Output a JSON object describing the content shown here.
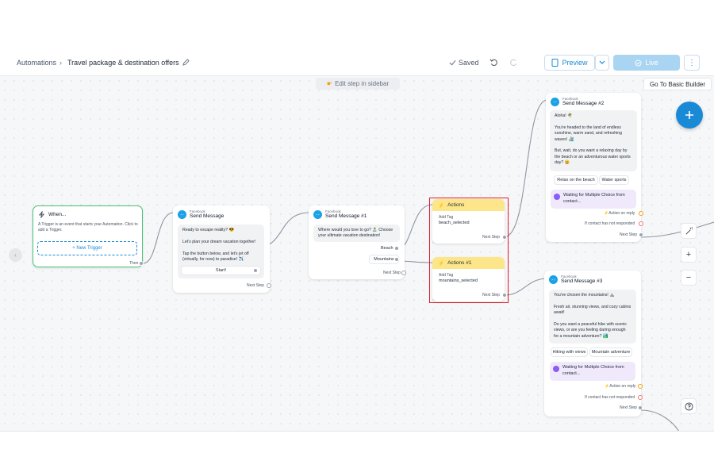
{
  "header": {
    "breadcrumb_root": "Automations",
    "title": "Travel package & destination offers",
    "saved": "Saved",
    "preview": "Preview",
    "live": "Live"
  },
  "canvas": {
    "hint": "Edit step in sidebar",
    "basic_builder": "Go To Basic Builder"
  },
  "trigger": {
    "title": "When...",
    "description": "A Trigger is an event that starts your Automation. Click to add a Trigger.",
    "new_trigger": "+ New Trigger",
    "then": "Then"
  },
  "send_message": {
    "channel": "Facebook",
    "title": "Send Message",
    "text": "Ready to escape reality? 😎\n\nLet's plan your dream vacation together!\n\nTap the button below, and let's jet off (virtually, for now) to paradise! ✈️",
    "button": "Start!",
    "next_step": "Next Step"
  },
  "send_message_1": {
    "channel": "Facebook",
    "title": "Send Message #1",
    "text": "Where would you love to go? 🏝️ Choose your ultimate vacation destination!",
    "option_1": "Beach",
    "option_2": "Mountains",
    "next_step": "Next Step"
  },
  "actions": {
    "title": "Actions",
    "label": "Add Tag",
    "value": "beach_selected",
    "next_step": "Next Step"
  },
  "actions_1": {
    "title": "Actions #1",
    "label": "Add Tag",
    "value": "mountains_selected",
    "next_step": "Next Step"
  },
  "send_message_2": {
    "channel": "Facebook",
    "title": "Send Message #2",
    "text": "Aloha! 🌴\n\nYou're headed to the land of endless sunshine, warm sand, and refreshing waves! 🏄\n\nBut, wait, do you want a relaxing day by the beach or an adventurous water sports day? 😄",
    "option_1": "Relax on the beach",
    "option_2": "Water sports",
    "waiting": "Waiting for Multiple Choice from contact...",
    "on_reply": "Action on reply",
    "no_response": "If contact has not responded",
    "next_step": "Next Step"
  },
  "send_message_3": {
    "channel": "Facebook",
    "title": "Send Message #3",
    "text": "You've chosen the mountains! ⛰️\n\nFresh air, stunning views, and cozy cabins await!\n\nDo you want a peaceful hike with scenic views, or are you feeling daring enough for a mountain adventure? 🏞️",
    "option_1": "Hiking with views",
    "option_2": "Mountain adventure",
    "waiting": "Waiting for Multiple Choice from contact...",
    "on_reply": "Action on reply",
    "no_response": "If contact has not responded",
    "next_step": "Next Step"
  },
  "colors": {
    "accent": "#1aa1e6",
    "live_button": "#a9d5f3",
    "trigger_border": "#4cc27a",
    "actions_header": "#fde68a",
    "highlight": "#e11d2b"
  }
}
